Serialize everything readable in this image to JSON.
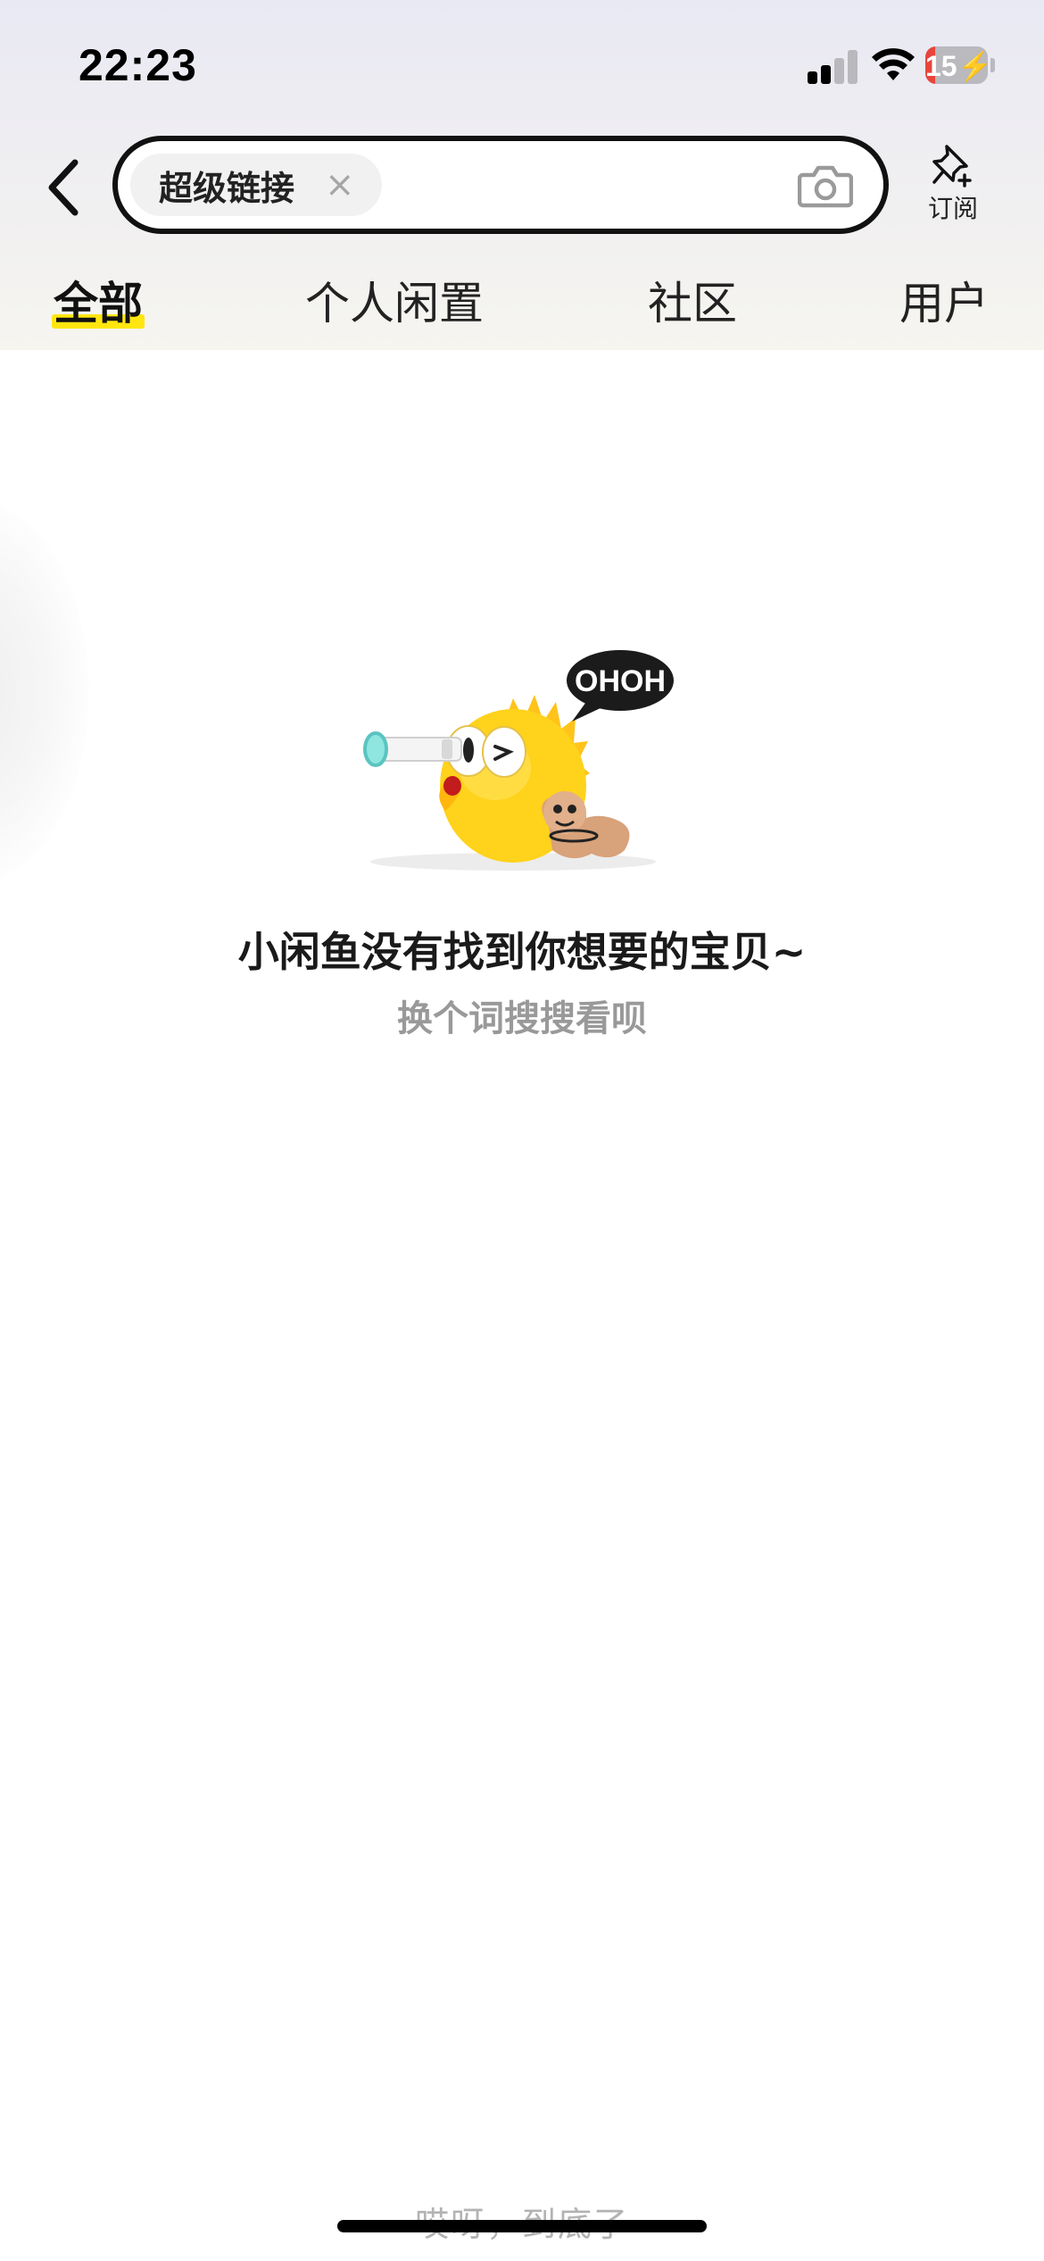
{
  "status_bar": {
    "time": "22:23",
    "battery_percent": "15",
    "battery_level": 0.15,
    "signal_bars_active": 2,
    "signal_bars_total": 4,
    "icons": [
      "signal-icon",
      "wifi-icon",
      "battery-charging-icon"
    ]
  },
  "search": {
    "query_chip": "超级链接",
    "clear_icon": "×",
    "camera_icon": "camera-icon",
    "back_icon": "chevron-left-icon"
  },
  "subscribe": {
    "label": "订阅",
    "icon": "pin-plus-icon"
  },
  "tabs": [
    {
      "label": "全部",
      "active": true
    },
    {
      "label": "个人闲置",
      "active": false
    },
    {
      "label": "社区",
      "active": false
    },
    {
      "label": "用户",
      "active": false
    }
  ],
  "empty_state": {
    "title": "小闲鱼没有找到你想要的宝贝~",
    "subtitle": "换个词搜搜看呗",
    "bubble_text": "OHOH"
  },
  "footer": {
    "end_text": "哎呀，到底了"
  },
  "colors": {
    "accent": "#ffe60f",
    "battery_low": "#e8453c",
    "mascot_yellow": "#ffd21c"
  }
}
